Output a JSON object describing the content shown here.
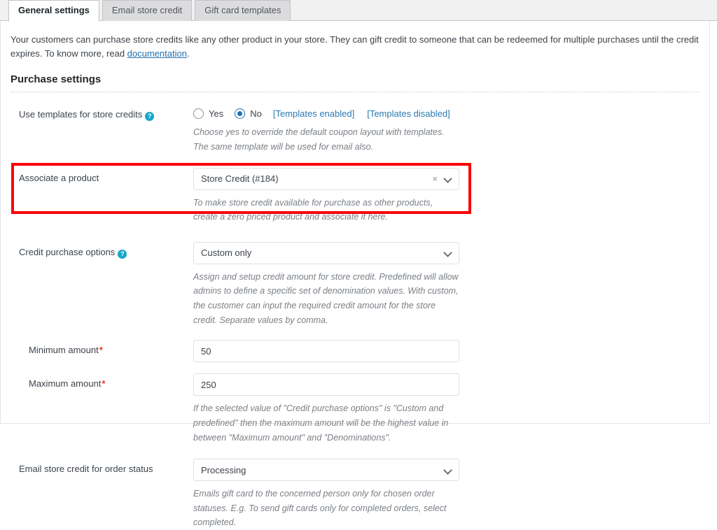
{
  "tabs": [
    {
      "label": "General settings",
      "active": true
    },
    {
      "label": "Email store credit",
      "active": false
    },
    {
      "label": "Gift card templates",
      "active": false
    }
  ],
  "intro": {
    "text_before": "Your customers can purchase store credits like any other product in your store. They can gift credit to someone that can be redeemed for multiple purchases until the credit expires. To know more, read ",
    "link": "documentation",
    "text_after": "."
  },
  "section": {
    "title": "Purchase settings"
  },
  "fields": {
    "use_templates": {
      "label": "Use templates for store credits",
      "help_icon": "help-icon",
      "options": [
        {
          "label": "Yes",
          "checked": false
        },
        {
          "label": "No",
          "checked": true
        }
      ],
      "links": [
        "[Templates enabled]",
        "[Templates disabled]"
      ],
      "description": "Choose yes to override the default coupon layout with templates. The same template will be used for email also."
    },
    "associate_product": {
      "label": "Associate a product",
      "value": "Store Credit (#184)",
      "clear_icon": "×",
      "description": "To make store credit available for purchase as other products, create a zero priced product and associate it here.",
      "highlighted": true,
      "highlight_color": "#fb0007"
    },
    "credit_purchase_options": {
      "label": "Credit purchase options",
      "help_icon": "help-icon",
      "value": "Custom only",
      "description": "Assign and setup credit amount for store credit. Predefined will allow admins to define a specific set of denomination values. With custom, the customer can input the required credit amount for the store credit. Separate values by comma."
    },
    "minimum_amount": {
      "label": "Minimum amount",
      "required_marker": "*",
      "value": "50"
    },
    "maximum_amount": {
      "label": "Maximum amount",
      "required_marker": "*",
      "value": "250",
      "description": "If the selected value of \"Credit purchase options\" is \"Custom and predefined\" then the maximum amount will be the highest value in between \"Maximum amount\" and \"Denominations\"."
    },
    "email_order_status": {
      "label": "Email store credit for order status",
      "value": "Processing",
      "description": "Emails gift card to the concerned person only for chosen order statuses. E.g. To send gift cards only for completed orders, select completed."
    }
  },
  "colors": {
    "link": "#2271b1",
    "accent": "#2a7ab0",
    "help_icon": "#18a7c8",
    "required": "#e2401c",
    "highlight": "#fb0007"
  }
}
